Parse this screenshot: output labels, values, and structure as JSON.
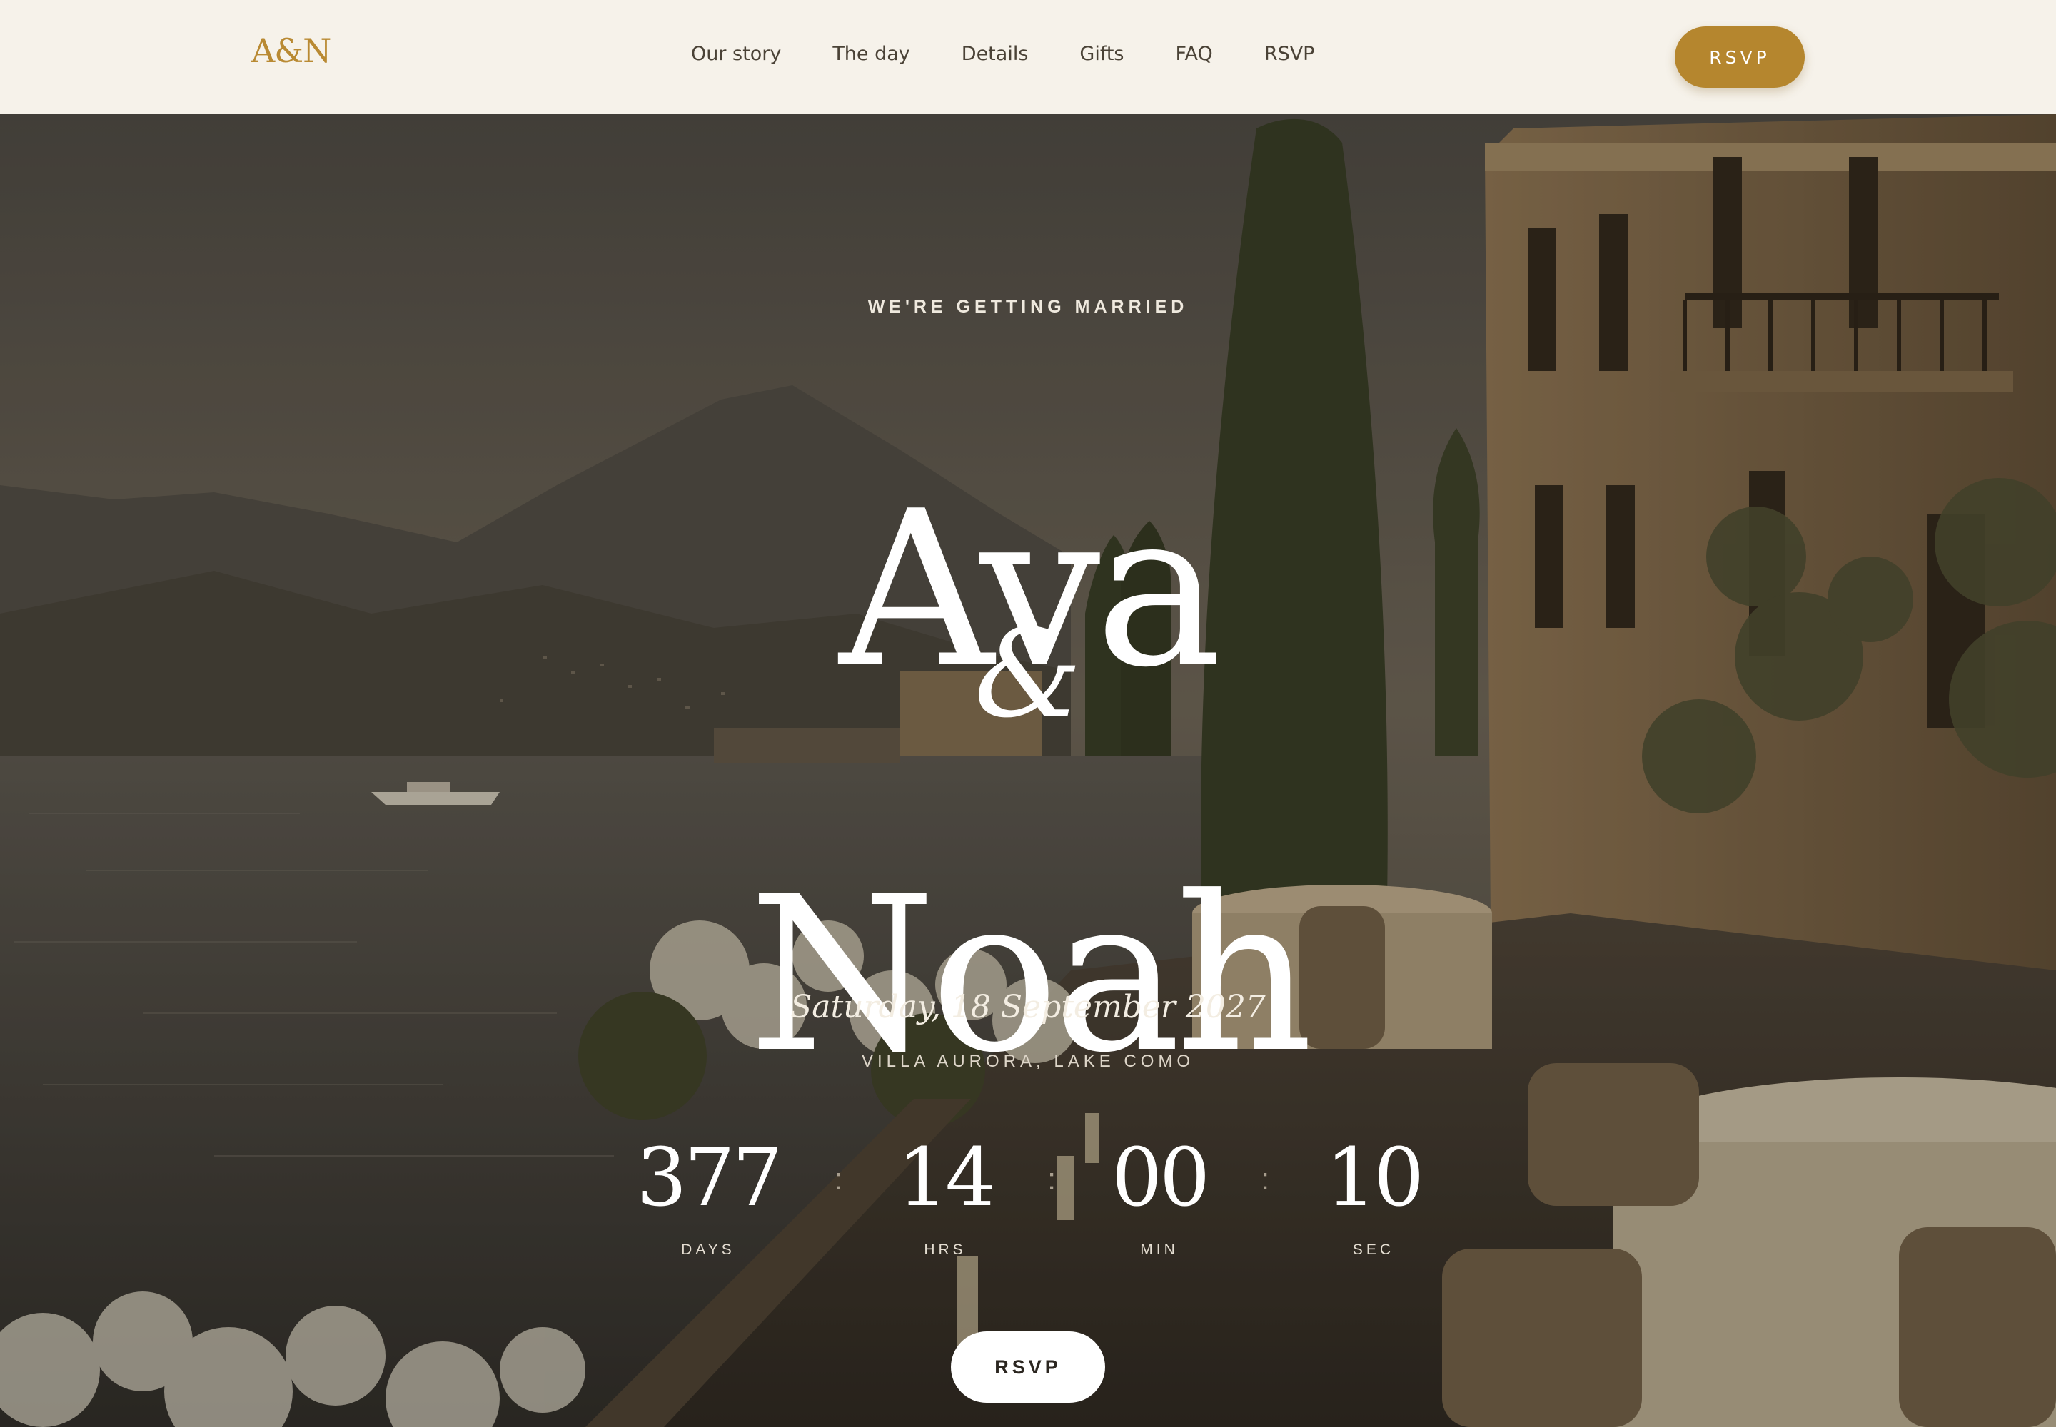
{
  "header": {
    "logo": "A&N",
    "nav": [
      "Our story",
      "The day",
      "Details",
      "Gifts",
      "FAQ",
      "RSVP"
    ],
    "rsvp_button": "RSVP",
    "accent": "#b5862e"
  },
  "hero": {
    "kicker": "WE'RE GETTING MARRIED",
    "name_1": "Ava",
    "ampersand": "&",
    "name_2": "Noah",
    "date": "Saturday, 18 September 2027",
    "venue": "VILLA AURORA, LAKE COMO",
    "countdown": {
      "days": "377",
      "hours": "14",
      "minutes": "00",
      "seconds": "10",
      "days_label": "DAYS",
      "hours_label": "HRS",
      "minutes_label": "MIN",
      "seconds_label": "SEC",
      "separator": ":"
    },
    "rsvp_button": "RSVP"
  }
}
